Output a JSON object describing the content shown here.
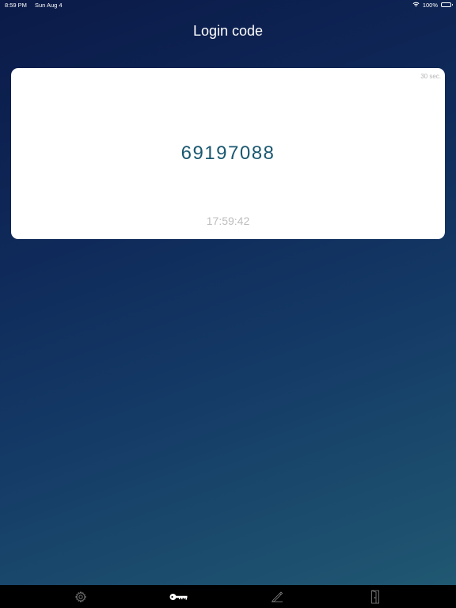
{
  "status_bar": {
    "time": "8:59 PM",
    "date": "Sun Aug 4",
    "battery": "100%",
    "wifi_icon": "wifi-icon",
    "battery_icon": "battery-icon"
  },
  "header": {
    "title": "Login code"
  },
  "card": {
    "timer": "30 sec.",
    "code": "69197088",
    "time": "17:59:42"
  },
  "tab_bar": {
    "items": [
      {
        "icon": "gear-icon"
      },
      {
        "icon": "key-icon"
      },
      {
        "icon": "sign-icon"
      },
      {
        "icon": "exit-door-icon"
      }
    ]
  }
}
